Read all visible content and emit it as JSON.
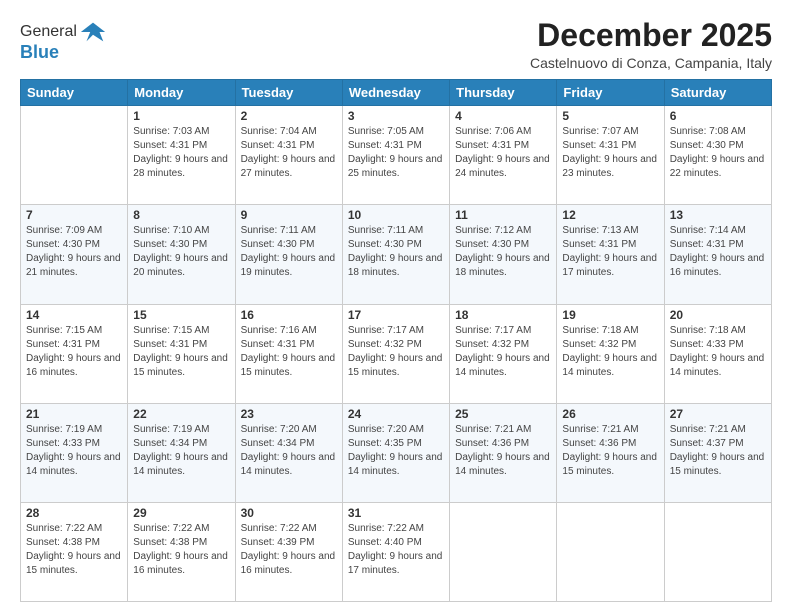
{
  "logo": {
    "general": "General",
    "blue": "Blue"
  },
  "header": {
    "month_title": "December 2025",
    "location": "Castelnuovo di Conza, Campania, Italy"
  },
  "days_of_week": [
    "Sunday",
    "Monday",
    "Tuesday",
    "Wednesday",
    "Thursday",
    "Friday",
    "Saturday"
  ],
  "weeks": [
    [
      {
        "day": "",
        "sunrise": "",
        "sunset": "",
        "daylight": ""
      },
      {
        "day": "1",
        "sunrise": "Sunrise: 7:03 AM",
        "sunset": "Sunset: 4:31 PM",
        "daylight": "Daylight: 9 hours and 28 minutes."
      },
      {
        "day": "2",
        "sunrise": "Sunrise: 7:04 AM",
        "sunset": "Sunset: 4:31 PM",
        "daylight": "Daylight: 9 hours and 27 minutes."
      },
      {
        "day": "3",
        "sunrise": "Sunrise: 7:05 AM",
        "sunset": "Sunset: 4:31 PM",
        "daylight": "Daylight: 9 hours and 25 minutes."
      },
      {
        "day": "4",
        "sunrise": "Sunrise: 7:06 AM",
        "sunset": "Sunset: 4:31 PM",
        "daylight": "Daylight: 9 hours and 24 minutes."
      },
      {
        "day": "5",
        "sunrise": "Sunrise: 7:07 AM",
        "sunset": "Sunset: 4:31 PM",
        "daylight": "Daylight: 9 hours and 23 minutes."
      },
      {
        "day": "6",
        "sunrise": "Sunrise: 7:08 AM",
        "sunset": "Sunset: 4:30 PM",
        "daylight": "Daylight: 9 hours and 22 minutes."
      }
    ],
    [
      {
        "day": "7",
        "sunrise": "Sunrise: 7:09 AM",
        "sunset": "Sunset: 4:30 PM",
        "daylight": "Daylight: 9 hours and 21 minutes."
      },
      {
        "day": "8",
        "sunrise": "Sunrise: 7:10 AM",
        "sunset": "Sunset: 4:30 PM",
        "daylight": "Daylight: 9 hours and 20 minutes."
      },
      {
        "day": "9",
        "sunrise": "Sunrise: 7:11 AM",
        "sunset": "Sunset: 4:30 PM",
        "daylight": "Daylight: 9 hours and 19 minutes."
      },
      {
        "day": "10",
        "sunrise": "Sunrise: 7:11 AM",
        "sunset": "Sunset: 4:30 PM",
        "daylight": "Daylight: 9 hours and 18 minutes."
      },
      {
        "day": "11",
        "sunrise": "Sunrise: 7:12 AM",
        "sunset": "Sunset: 4:30 PM",
        "daylight": "Daylight: 9 hours and 18 minutes."
      },
      {
        "day": "12",
        "sunrise": "Sunrise: 7:13 AM",
        "sunset": "Sunset: 4:31 PM",
        "daylight": "Daylight: 9 hours and 17 minutes."
      },
      {
        "day": "13",
        "sunrise": "Sunrise: 7:14 AM",
        "sunset": "Sunset: 4:31 PM",
        "daylight": "Daylight: 9 hours and 16 minutes."
      }
    ],
    [
      {
        "day": "14",
        "sunrise": "Sunrise: 7:15 AM",
        "sunset": "Sunset: 4:31 PM",
        "daylight": "Daylight: 9 hours and 16 minutes."
      },
      {
        "day": "15",
        "sunrise": "Sunrise: 7:15 AM",
        "sunset": "Sunset: 4:31 PM",
        "daylight": "Daylight: 9 hours and 15 minutes."
      },
      {
        "day": "16",
        "sunrise": "Sunrise: 7:16 AM",
        "sunset": "Sunset: 4:31 PM",
        "daylight": "Daylight: 9 hours and 15 minutes."
      },
      {
        "day": "17",
        "sunrise": "Sunrise: 7:17 AM",
        "sunset": "Sunset: 4:32 PM",
        "daylight": "Daylight: 9 hours and 15 minutes."
      },
      {
        "day": "18",
        "sunrise": "Sunrise: 7:17 AM",
        "sunset": "Sunset: 4:32 PM",
        "daylight": "Daylight: 9 hours and 14 minutes."
      },
      {
        "day": "19",
        "sunrise": "Sunrise: 7:18 AM",
        "sunset": "Sunset: 4:32 PM",
        "daylight": "Daylight: 9 hours and 14 minutes."
      },
      {
        "day": "20",
        "sunrise": "Sunrise: 7:18 AM",
        "sunset": "Sunset: 4:33 PM",
        "daylight": "Daylight: 9 hours and 14 minutes."
      }
    ],
    [
      {
        "day": "21",
        "sunrise": "Sunrise: 7:19 AM",
        "sunset": "Sunset: 4:33 PM",
        "daylight": "Daylight: 9 hours and 14 minutes."
      },
      {
        "day": "22",
        "sunrise": "Sunrise: 7:19 AM",
        "sunset": "Sunset: 4:34 PM",
        "daylight": "Daylight: 9 hours and 14 minutes."
      },
      {
        "day": "23",
        "sunrise": "Sunrise: 7:20 AM",
        "sunset": "Sunset: 4:34 PM",
        "daylight": "Daylight: 9 hours and 14 minutes."
      },
      {
        "day": "24",
        "sunrise": "Sunrise: 7:20 AM",
        "sunset": "Sunset: 4:35 PM",
        "daylight": "Daylight: 9 hours and 14 minutes."
      },
      {
        "day": "25",
        "sunrise": "Sunrise: 7:21 AM",
        "sunset": "Sunset: 4:36 PM",
        "daylight": "Daylight: 9 hours and 14 minutes."
      },
      {
        "day": "26",
        "sunrise": "Sunrise: 7:21 AM",
        "sunset": "Sunset: 4:36 PM",
        "daylight": "Daylight: 9 hours and 15 minutes."
      },
      {
        "day": "27",
        "sunrise": "Sunrise: 7:21 AM",
        "sunset": "Sunset: 4:37 PM",
        "daylight": "Daylight: 9 hours and 15 minutes."
      }
    ],
    [
      {
        "day": "28",
        "sunrise": "Sunrise: 7:22 AM",
        "sunset": "Sunset: 4:38 PM",
        "daylight": "Daylight: 9 hours and 15 minutes."
      },
      {
        "day": "29",
        "sunrise": "Sunrise: 7:22 AM",
        "sunset": "Sunset: 4:38 PM",
        "daylight": "Daylight: 9 hours and 16 minutes."
      },
      {
        "day": "30",
        "sunrise": "Sunrise: 7:22 AM",
        "sunset": "Sunset: 4:39 PM",
        "daylight": "Daylight: 9 hours and 16 minutes."
      },
      {
        "day": "31",
        "sunrise": "Sunrise: 7:22 AM",
        "sunset": "Sunset: 4:40 PM",
        "daylight": "Daylight: 9 hours and 17 minutes."
      },
      {
        "day": "",
        "sunrise": "",
        "sunset": "",
        "daylight": ""
      },
      {
        "day": "",
        "sunrise": "",
        "sunset": "",
        "daylight": ""
      },
      {
        "day": "",
        "sunrise": "",
        "sunset": "",
        "daylight": ""
      }
    ]
  ]
}
